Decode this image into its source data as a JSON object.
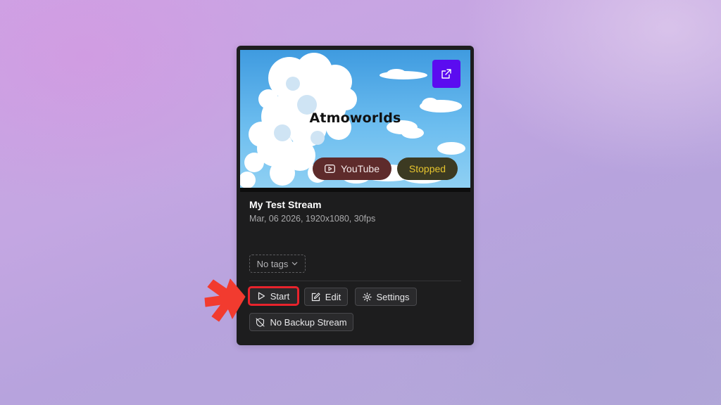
{
  "stream": {
    "thumbnail_title": "Atmoworlds",
    "platform": "YouTube",
    "status": "Stopped",
    "name": "My Test Stream",
    "meta": "Mar, 06 2026, 1920x1080, 30fps",
    "tags_label": "No tags"
  },
  "actions": {
    "start": "Start",
    "edit": "Edit",
    "settings": "Settings",
    "backup": "No Backup Stream"
  },
  "colors": {
    "accent": "#5b0cf0",
    "highlight": "#e8232c",
    "status_text": "#e6c42e"
  },
  "icons": [
    "external-link-icon",
    "youtube-icon",
    "chevron-down-icon",
    "play-icon",
    "edit-icon",
    "gear-icon",
    "shield-off-icon",
    "pointer-arrow-icon"
  ]
}
